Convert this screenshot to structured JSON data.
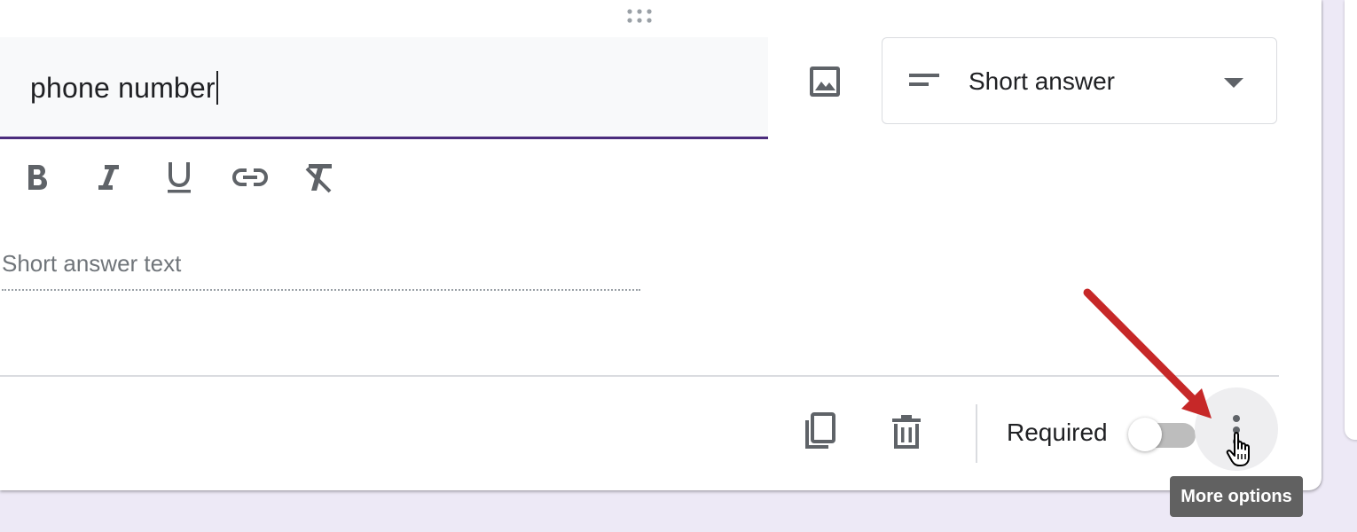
{
  "question": {
    "title_value": "phone number"
  },
  "question_type": {
    "selected": "Short answer",
    "icon": "short-text-icon"
  },
  "format_toolbar": {
    "items": [
      "bold-icon",
      "italic-icon",
      "underline-icon",
      "link-icon",
      "clear-format-icon"
    ]
  },
  "answer": {
    "placeholder": "Short answer text"
  },
  "footer": {
    "required_label": "Required",
    "required_on": false,
    "copy_icon": "copy-icon",
    "delete_icon": "trash-icon",
    "more_icon": "more-vert-icon"
  },
  "tooltip": {
    "text": "More options"
  },
  "colors": {
    "accent": "#4b2c7d",
    "annotation_arrow": "#c62828",
    "background": "#ede9f6",
    "tooltip_bg": "#616161"
  }
}
